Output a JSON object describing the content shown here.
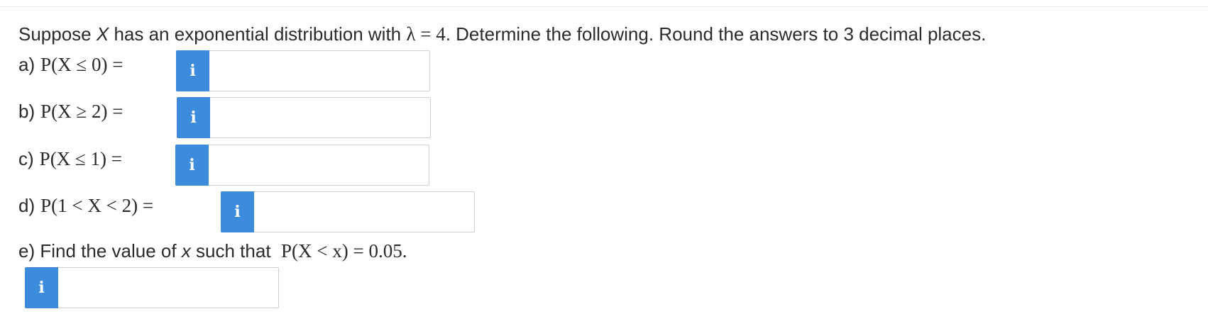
{
  "question": {
    "prefix": "Suppose ",
    "var_x": "X",
    "middle": " has an exponential distribution with ",
    "lambda_expr": "λ = 4",
    "suffix": ". Determine the following. Round the answers to 3 decimal places."
  },
  "parts": {
    "a": {
      "label": "a)",
      "expr": "P(X ≤ 0) =",
      "value": ""
    },
    "b": {
      "label": "b)",
      "expr": "P(X ≥ 2) =",
      "value": ""
    },
    "c": {
      "label": "c)",
      "expr": "P(X ≤ 1) =",
      "value": ""
    },
    "d": {
      "label": "d)",
      "expr": "P(1 < X < 2) =",
      "value": ""
    },
    "e": {
      "label": "e) Find the value of ",
      "var": "x",
      "text": " such that ",
      "expr": "P(X < x) = 0.05.",
      "value": ""
    }
  },
  "icons": {
    "info": "i",
    "info_color": "#3d8bdc"
  }
}
